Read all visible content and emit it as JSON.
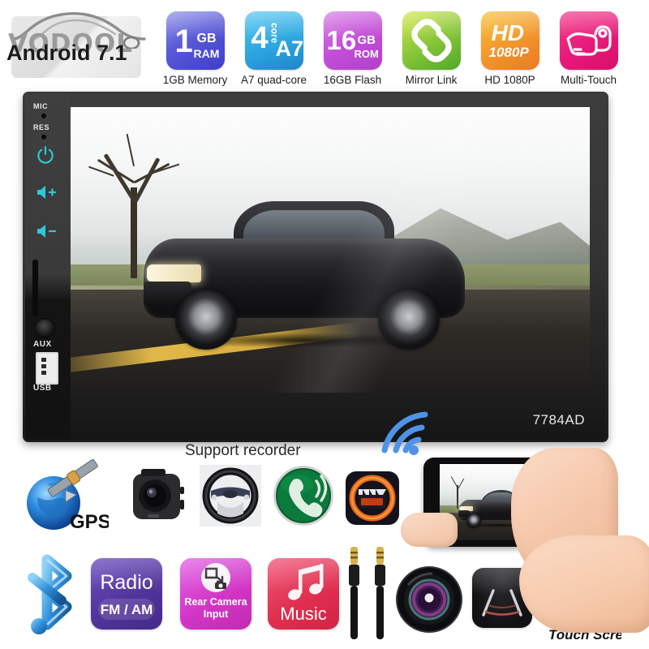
{
  "brand": {
    "watermark": "VODOOL",
    "os_label": "Android 7.1"
  },
  "spec_badges": [
    {
      "id": "ram",
      "tile_big": "1",
      "tile_sub1": "GB",
      "tile_sub2": "RAM",
      "caption": "1GB Memory",
      "color": "#5a5ad8",
      "icon": "memory-badge-icon"
    },
    {
      "id": "cpu",
      "tile_big": "4",
      "tile_sub1": "core",
      "tile_sub2": "A7",
      "caption": "A7 quad-core",
      "color": "#2da6e0",
      "icon": "cpu-badge-icon"
    },
    {
      "id": "rom",
      "tile_big": "16",
      "tile_sub1": "GB",
      "tile_sub2": "ROM",
      "caption": "16GB Flash",
      "color": "#c44fd8",
      "icon": "storage-badge-icon"
    },
    {
      "id": "mirrorlink",
      "tile_big": "",
      "tile_sub1": "",
      "tile_sub2": "",
      "caption": "Mirror Link",
      "color": "#8cc83c",
      "icon": "chain-link-icon"
    },
    {
      "id": "hd",
      "tile_big": "HD",
      "tile_sub1": "",
      "tile_sub2": "1080P",
      "caption": "HD 1080P",
      "color": "#f2952c",
      "icon": "hd-badge-icon"
    },
    {
      "id": "multitouch",
      "tile_big": "",
      "tile_sub1": "",
      "tile_sub2": "",
      "caption": "Multi-Touch",
      "color": "#e8197a",
      "icon": "multi-touch-hand-icon"
    }
  ],
  "device": {
    "model_number": "7784AD",
    "controls": [
      {
        "label": "MIC",
        "type": "hole"
      },
      {
        "label": "RES",
        "type": "hole"
      },
      {
        "label": "",
        "type": "power-icon"
      },
      {
        "label": "",
        "type": "volume-up-icon"
      },
      {
        "label": "",
        "type": "volume-down-icon"
      },
      {
        "label": "AUX",
        "type": "aux-jack-icon"
      },
      {
        "label": "USB",
        "type": "usb-port-icon"
      }
    ]
  },
  "middle_row": {
    "recorder_label": "Support recorder",
    "wifi_icon": "wifi-signal-icon",
    "icons": [
      {
        "id": "gps",
        "name": "gps-globe-satellite-icon",
        "caption": "GPS"
      },
      {
        "id": "dashcam",
        "name": "dashcam-recorder-icon",
        "caption": ""
      },
      {
        "id": "steering",
        "name": "steering-wheel-control-icon",
        "caption": ""
      },
      {
        "id": "handsfree",
        "name": "phone-call-icon",
        "caption": ""
      },
      {
        "id": "player",
        "name": "media-player-icon",
        "caption": ""
      },
      {
        "id": "mirror",
        "name": "phone-in-hand-mirrorlink-icon",
        "caption": ""
      }
    ]
  },
  "bottom_row": {
    "icons": [
      {
        "id": "bluetooth",
        "name": "bluetooth-icon",
        "label": "",
        "sub": "",
        "color": "#2d8fd6"
      },
      {
        "id": "radio",
        "name": "radio-tile",
        "label": "Radio",
        "sub": "FM / AM",
        "color": "#5b3fa8"
      },
      {
        "id": "rearcam",
        "name": "rear-camera-input-tile",
        "label": "Rear Camera",
        "sub": "Input",
        "color": "#d93fc0"
      },
      {
        "id": "music",
        "name": "music-tile",
        "label": "Music",
        "sub": "",
        "color": "#e8385f"
      },
      {
        "id": "auxcable",
        "name": "aux-cable-icon",
        "label": "",
        "sub": "",
        "color": "#1a1a1a"
      },
      {
        "id": "lens",
        "name": "camera-lens-icon",
        "label": "",
        "sub": "",
        "color": "#151515"
      },
      {
        "id": "parkguide",
        "name": "parking-guideline-tile",
        "label": "",
        "sub": "",
        "color": "#121212"
      },
      {
        "id": "touch",
        "name": "touch-screen-icon",
        "label": "Touch Screen",
        "sub": "",
        "color": "#2f6fb5"
      }
    ]
  }
}
